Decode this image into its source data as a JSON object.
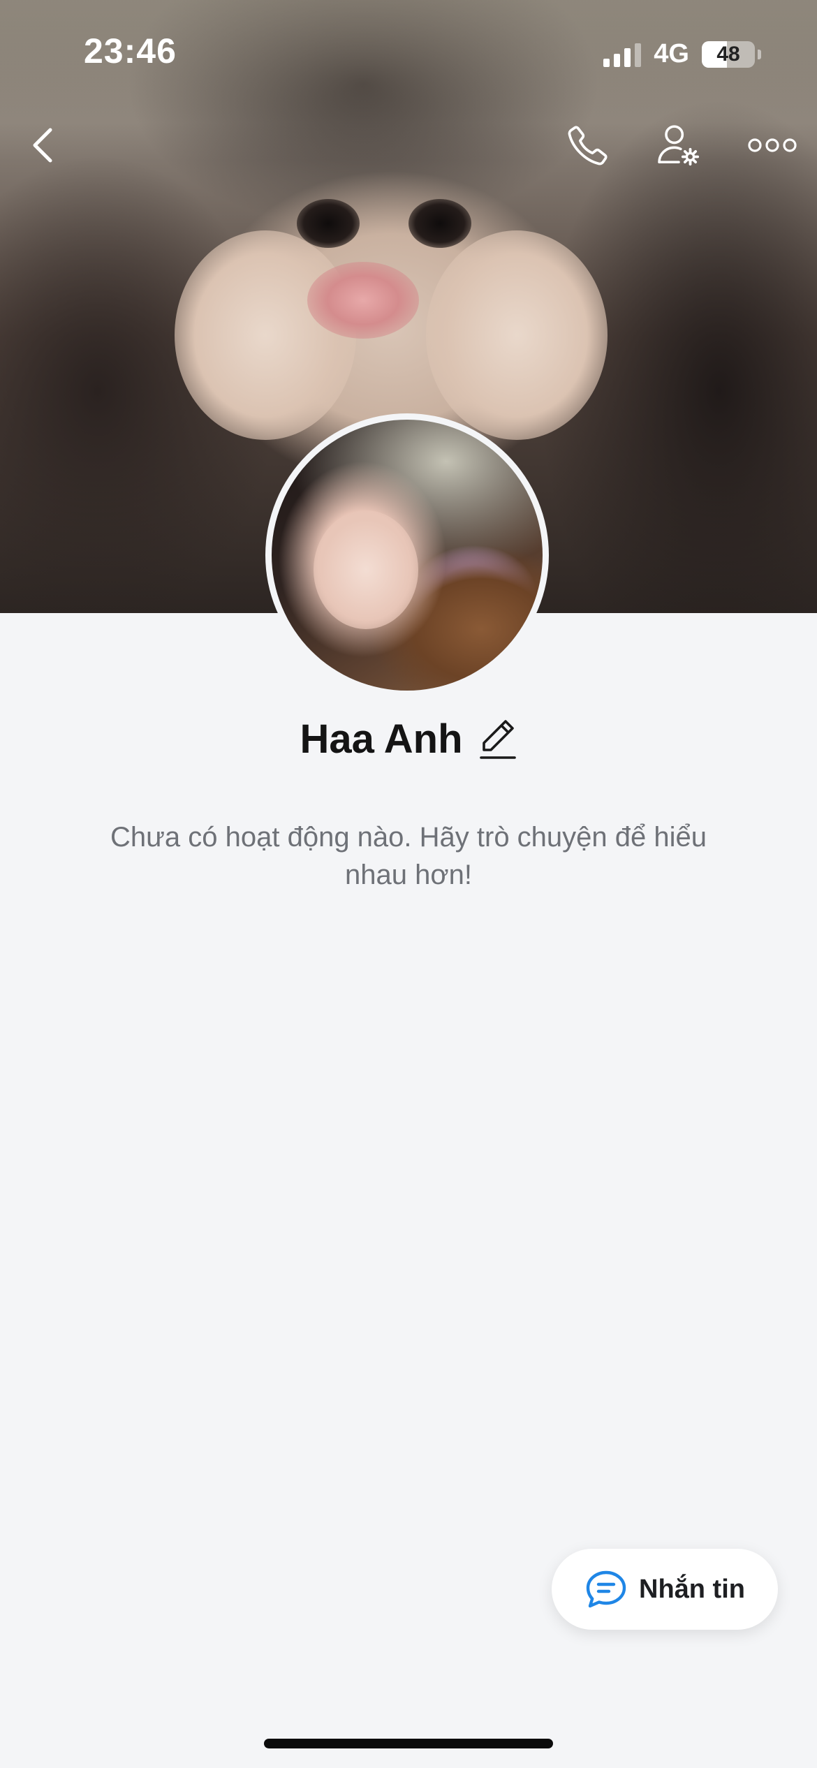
{
  "status_bar": {
    "time": "23:46",
    "network": "4G",
    "battery": "48",
    "battery_level_percent": 48
  },
  "nav": {
    "back_icon": "chevron-left-icon",
    "call_icon": "phone-icon",
    "settings_icon": "user-settings-icon",
    "more_icon": "more-horizontal-icon"
  },
  "profile": {
    "name": "Haa Anh",
    "edit_icon": "pencil-icon",
    "empty_message": "Chưa có hoạt động nào. Hãy trò chuyện để hiểu nhau hơn!"
  },
  "actions": {
    "message_label": "Nhắn tin",
    "message_icon": "chat-bubble-icon",
    "accent_color": "#1f86e6"
  }
}
